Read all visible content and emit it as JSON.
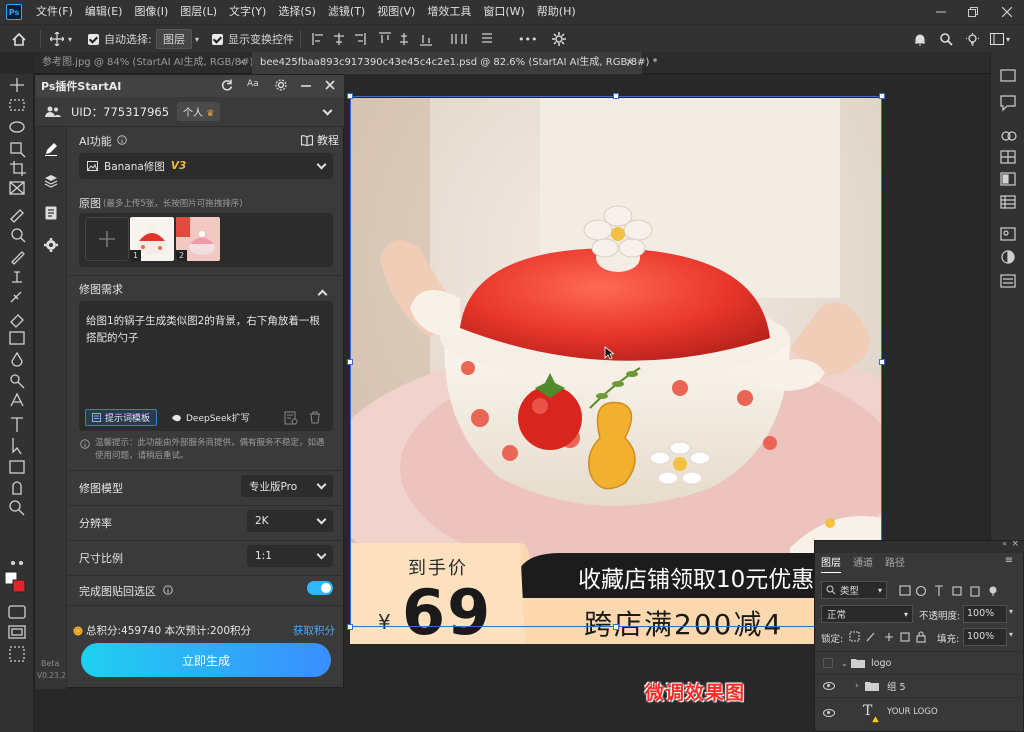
{
  "menubar": {
    "logo": "Ps",
    "items": [
      "文件(F)",
      "编辑(E)",
      "图像(I)",
      "图层(L)",
      "文字(Y)",
      "选择(S)",
      "滤镜(T)",
      "视图(V)",
      "增效工具",
      "窗口(W)",
      "帮助(H)"
    ]
  },
  "options": {
    "auto_select_label": "自动选择:",
    "auto_select_value": "图层",
    "show_transform_label": "显示变换控件",
    "more": "•••"
  },
  "tabs": [
    {
      "label": "参考图.jpg @ 84% (StartAI AI生成, RGB/8#) *",
      "close": "×"
    },
    {
      "label": "bee425fbaa893c917390c43e45c4c2e1.psd @ 82.6% (StartAI AI生成, RGB/8#) *",
      "close": "×"
    }
  ],
  "plugin": {
    "title": "Ps插件StartAI",
    "uid": "UID：775317965",
    "account_type": "个人",
    "ai_function_label": "AI功能",
    "tutorial_label": "教程",
    "function_value": "Banana修图",
    "function_version": "V3",
    "source_label": "原图",
    "source_hint": "(最多上传5张，长按图片可拖拽排序)",
    "thumb_numbers": [
      "1",
      "2"
    ],
    "requirement_label": "修图需求",
    "requirement_text": "给图1的锅子生成类似图2的背景，右下角放着一根搭配的勺子",
    "prompt_template_btn": "提示词模板",
    "deepseek_btn": "DeepSeek扩写",
    "tip_text": "温馨提示：此功能由外部服务商提供，偶有服务不稳定，如遇使用问题，请稍后重试。",
    "model_label": "修图模型",
    "model_value": "专业版Pro",
    "resolution_label": "分辨率",
    "resolution_value": "2K",
    "ratio_label": "尺寸比例",
    "ratio_value": "1:1",
    "paste_back_label": "完成图贴回选区",
    "paste_back_on": true,
    "points_text": "总积分:459740 本次预计:200积分",
    "get_points": "获取积分",
    "generate_btn": "立即生成",
    "beta": "Beta",
    "version": "V0.23.2"
  },
  "banner": {
    "to_hand_label": "到手价",
    "currency": "¥",
    "price": "69",
    "coupon_text": "收藏店铺领取10元优惠",
    "promo_text": "跨店满200减4"
  },
  "layers": {
    "tabs": [
      "图层",
      "通道",
      "路径"
    ],
    "filter_label": "类型",
    "blend_mode": "正常",
    "opacity_label": "不透明度:",
    "opacity_value": "100%",
    "lock_label": "锁定:",
    "fill_label": "填充:",
    "fill_value": "100%",
    "rows": [
      {
        "name": "logo",
        "kind": "group"
      },
      {
        "name": "组 5",
        "kind": "group"
      },
      {
        "name": "YOUR LOGO",
        "kind": "text"
      }
    ]
  },
  "caption": "微调效果图",
  "colors": {
    "accent_blue": "#31a8ff",
    "toggle": "#2fb7ff",
    "generate_gradient_start": "#1fd1f0",
    "generate_gradient_end": "#3a8dff",
    "get_points": "#4aa8ff",
    "caption_red": "#ff2a2a"
  }
}
